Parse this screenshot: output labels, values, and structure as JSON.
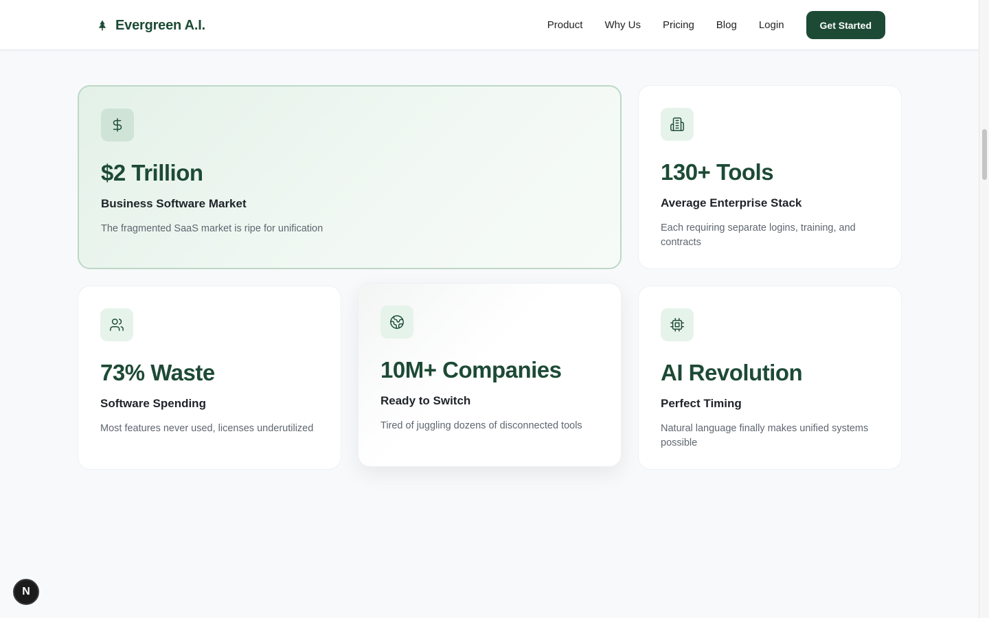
{
  "header": {
    "brand_name": "Evergreen A.I.",
    "nav": {
      "product": "Product",
      "why_us": "Why Us",
      "pricing": "Pricing",
      "blog": "Blog",
      "login": "Login",
      "cta": "Get Started"
    }
  },
  "cards": [
    {
      "icon": "dollar-icon",
      "stat": "$2 Trillion",
      "title": "Business Software Market",
      "description": "The fragmented SaaS market is ripe for unification"
    },
    {
      "icon": "building-icon",
      "stat": "130+ Tools",
      "title": "Average Enterprise Stack",
      "description": "Each requiring separate logins, training, and contracts"
    },
    {
      "icon": "users-icon",
      "stat": "73% Waste",
      "title": "Software Spending",
      "description": "Most features never used, licenses underutilized"
    },
    {
      "icon": "globe-icon",
      "stat": "10M+ Companies",
      "title": "Ready to Switch",
      "description": "Tired of juggling dozens of disconnected tools"
    },
    {
      "icon": "cpu-icon",
      "stat": "AI Revolution",
      "title": "Perfect Timing",
      "description": "Natural language finally makes unified systems possible"
    }
  ],
  "dev_badge": "N",
  "colors": {
    "brand_green": "#1d4a35",
    "icon_bg": "#e6f3eb",
    "page_bg": "#f8f9fb"
  }
}
